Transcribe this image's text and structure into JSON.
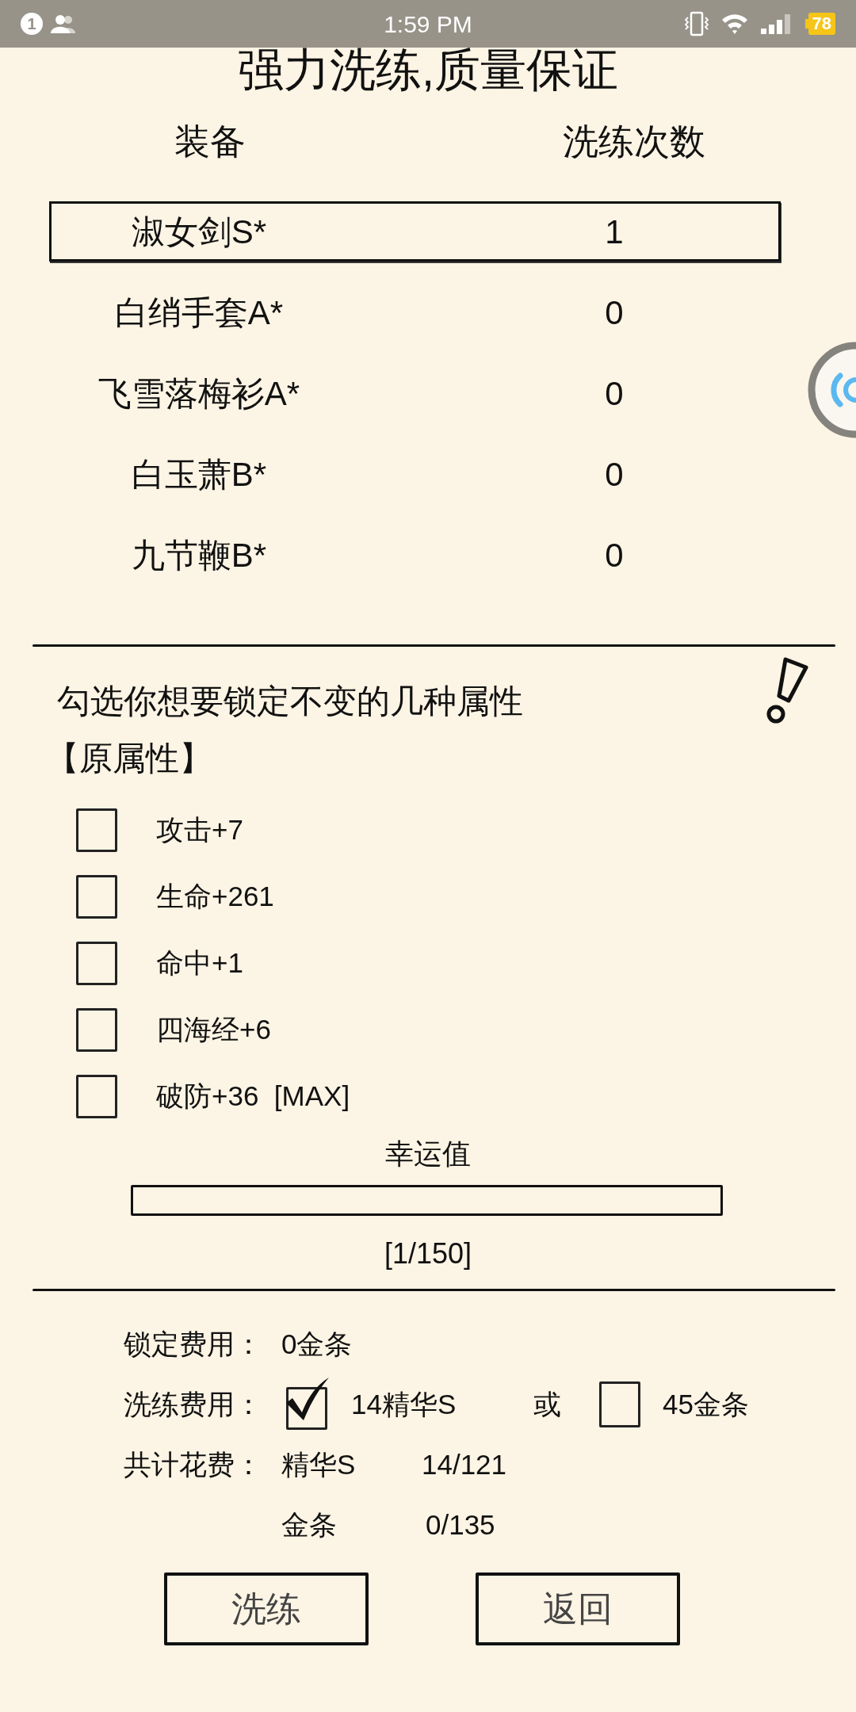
{
  "status_bar": {
    "notification_count": "1",
    "time": "1:59 PM",
    "battery": "78"
  },
  "title": "强力洗练,质量保证",
  "table": {
    "columns": [
      "装备",
      "洗练次数"
    ],
    "rows": [
      {
        "name": "淑女剑S*",
        "count": "1",
        "selected": true
      },
      {
        "name": "白绡手套A*",
        "count": "0",
        "selected": false
      },
      {
        "name": "飞雪落梅衫A*",
        "count": "0",
        "selected": false
      },
      {
        "name": "白玉萧B*",
        "count": "0",
        "selected": false
      },
      {
        "name": "九节鞭B*",
        "count": "0",
        "selected": false
      }
    ]
  },
  "lock_section": {
    "prompt": "勾选你想要锁定不变的几种属性",
    "group_label": "【原属性】",
    "attributes": [
      {
        "label": "攻击+7",
        "checked": false
      },
      {
        "label": "生命+261",
        "checked": false
      },
      {
        "label": "命中+1",
        "checked": false
      },
      {
        "label": "四海经+6",
        "checked": false
      },
      {
        "label": "破防+36  [MAX]",
        "checked": false
      }
    ]
  },
  "luck": {
    "label": "幸运值",
    "reading": "[1/150]"
  },
  "costs": {
    "lock_fee": {
      "label": "锁定费用：",
      "value": "0金条"
    },
    "refine_fee": {
      "label": "洗练费用：",
      "separator": "或",
      "options": [
        {
          "label": "14精华S",
          "checked": true
        },
        {
          "label": "45金条",
          "checked": false
        }
      ]
    },
    "total": {
      "label": "共计花费：",
      "items": [
        {
          "name": "精华S",
          "amount": "14/121"
        },
        {
          "name": "金条",
          "amount": "0/135"
        }
      ]
    }
  },
  "buttons": [
    "洗练",
    "返回"
  ]
}
